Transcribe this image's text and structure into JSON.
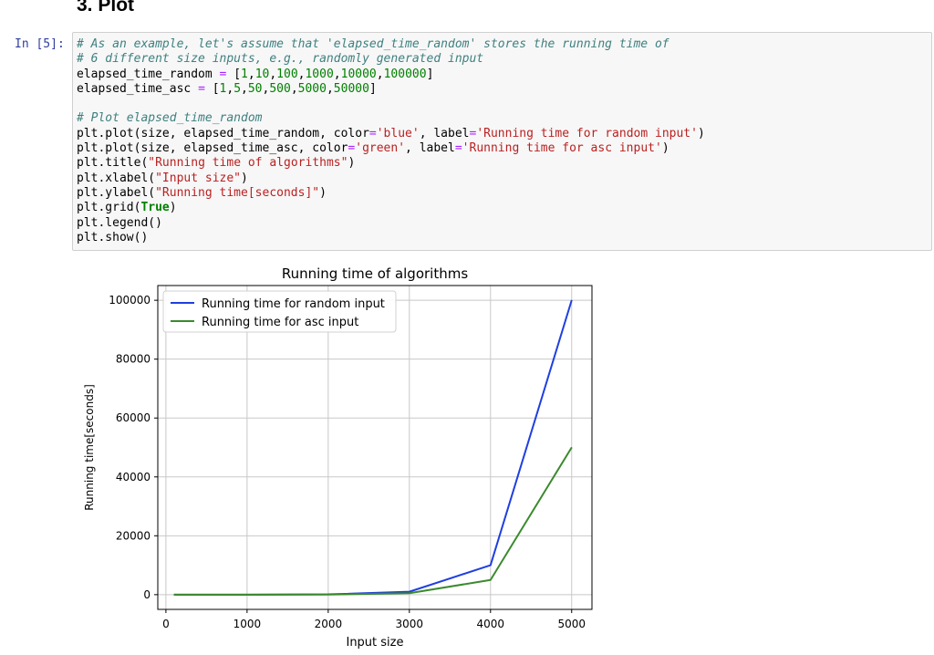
{
  "heading": "3. Plot",
  "cell": {
    "prompt": "In [5]:",
    "lines": [
      [
        {
          "t": "# As an example, let's assume that 'elapsed_time_random' stores the running time of",
          "c": "cm"
        }
      ],
      [
        {
          "t": "# 6 different size inputs, e.g., randomly generated input",
          "c": "cm"
        }
      ],
      [
        {
          "t": "elapsed_time_random ",
          "c": ""
        },
        {
          "t": "=",
          "c": "op"
        },
        {
          "t": " [",
          "c": ""
        },
        {
          "t": "1",
          "c": "num"
        },
        {
          "t": ",",
          "c": ""
        },
        {
          "t": "10",
          "c": "num"
        },
        {
          "t": ",",
          "c": ""
        },
        {
          "t": "100",
          "c": "num"
        },
        {
          "t": ",",
          "c": ""
        },
        {
          "t": "1000",
          "c": "num"
        },
        {
          "t": ",",
          "c": ""
        },
        {
          "t": "10000",
          "c": "num"
        },
        {
          "t": ",",
          "c": ""
        },
        {
          "t": "100000",
          "c": "num"
        },
        {
          "t": "]",
          "c": ""
        }
      ],
      [
        {
          "t": "elapsed_time_asc ",
          "c": ""
        },
        {
          "t": "=",
          "c": "op"
        },
        {
          "t": " [",
          "c": ""
        },
        {
          "t": "1",
          "c": "num"
        },
        {
          "t": ",",
          "c": ""
        },
        {
          "t": "5",
          "c": "num"
        },
        {
          "t": ",",
          "c": ""
        },
        {
          "t": "50",
          "c": "num"
        },
        {
          "t": ",",
          "c": ""
        },
        {
          "t": "500",
          "c": "num"
        },
        {
          "t": ",",
          "c": ""
        },
        {
          "t": "5000",
          "c": "num"
        },
        {
          "t": ",",
          "c": ""
        },
        {
          "t": "50000",
          "c": "num"
        },
        {
          "t": "]",
          "c": ""
        }
      ],
      [],
      [
        {
          "t": "# Plot elapsed_time_random",
          "c": "cm"
        }
      ],
      [
        {
          "t": "plt.plot(size, elapsed_time_random, color",
          "c": ""
        },
        {
          "t": "=",
          "c": "op"
        },
        {
          "t": "'blue'",
          "c": "st"
        },
        {
          "t": ", label",
          "c": ""
        },
        {
          "t": "=",
          "c": "op"
        },
        {
          "t": "'Running time for random input'",
          "c": "st"
        },
        {
          "t": ")",
          "c": ""
        }
      ],
      [
        {
          "t": "plt.plot(size, elapsed_time_asc, color",
          "c": ""
        },
        {
          "t": "=",
          "c": "op"
        },
        {
          "t": "'green'",
          "c": "st"
        },
        {
          "t": ", label",
          "c": ""
        },
        {
          "t": "=",
          "c": "op"
        },
        {
          "t": "'Running time for asc input'",
          "c": "st"
        },
        {
          "t": ")",
          "c": ""
        }
      ],
      [
        {
          "t": "plt.title(",
          "c": ""
        },
        {
          "t": "\"Running time of algorithms\"",
          "c": "st"
        },
        {
          "t": ")",
          "c": ""
        }
      ],
      [
        {
          "t": "plt.xlabel(",
          "c": ""
        },
        {
          "t": "\"Input size\"",
          "c": "st"
        },
        {
          "t": ")",
          "c": ""
        }
      ],
      [
        {
          "t": "plt.ylabel(",
          "c": ""
        },
        {
          "t": "\"Running time[seconds]\"",
          "c": "st"
        },
        {
          "t": ")",
          "c": ""
        }
      ],
      [
        {
          "t": "plt.grid(",
          "c": ""
        },
        {
          "t": "True",
          "c": "kw"
        },
        {
          "t": ")",
          "c": ""
        }
      ],
      [
        {
          "t": "plt.legend()",
          "c": ""
        }
      ],
      [
        {
          "t": "plt.show()",
          "c": ""
        }
      ]
    ]
  },
  "chart_data": {
    "type": "line",
    "title": "Running time of algorithms",
    "xlabel": "Input size",
    "ylabel": "Running time[seconds]",
    "x": [
      100,
      1000,
      2000,
      3000,
      4000,
      5000
    ],
    "xlim": [
      -100,
      5250
    ],
    "ylim": [
      -5000,
      105000
    ],
    "xticks": [
      0,
      1000,
      2000,
      3000,
      4000,
      5000
    ],
    "yticks": [
      0,
      20000,
      40000,
      60000,
      80000,
      100000
    ],
    "grid": true,
    "legend_loc": "upper left",
    "series": [
      {
        "name": "Running time for random input",
        "color": "#1f3fe0",
        "values": [
          1,
          10,
          100,
          1000,
          10000,
          100000
        ]
      },
      {
        "name": "Running time for asc input",
        "color": "#3b8a2e",
        "values": [
          1,
          5,
          50,
          500,
          5000,
          50000
        ]
      }
    ]
  }
}
